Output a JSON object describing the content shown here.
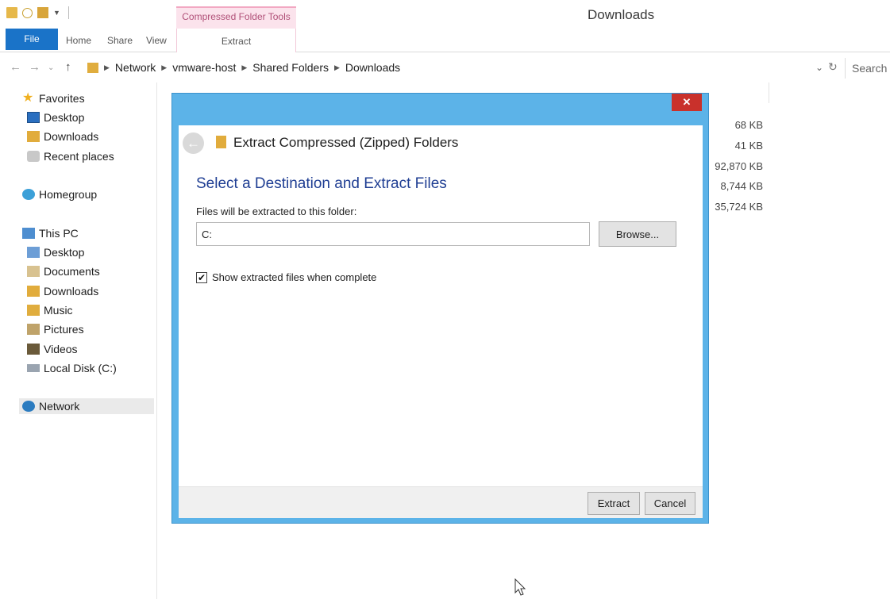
{
  "titlebar": {
    "context_tab": "Compressed Folder Tools",
    "window_title": "Downloads"
  },
  "ribbon": {
    "file": "File",
    "home": "Home",
    "share": "Share",
    "view": "View",
    "extract": "Extract"
  },
  "address": {
    "path": [
      "Network",
      "vmware-host",
      "Shared Folders",
      "Downloads"
    ],
    "search_placeholder": "Search"
  },
  "navpane": {
    "favorites": "Favorites",
    "desktop": "Desktop",
    "downloads": "Downloads",
    "recent": "Recent places",
    "homegroup": "Homegroup",
    "thispc": "This PC",
    "pc_desktop": "Desktop",
    "pc_documents": "Documents",
    "pc_downloads": "Downloads",
    "pc_music": "Music",
    "pc_pictures": "Pictures",
    "pc_videos": "Videos",
    "pc_disk": "Local Disk (C:)",
    "network": "Network"
  },
  "file_sizes": [
    "68 KB",
    "41 KB",
    "92,870 KB",
    "8,744 KB",
    "35,724 KB"
  ],
  "dialog": {
    "close": "✕",
    "title": "Extract Compressed (Zipped) Folders",
    "section_title": "Select a Destination and Extract Files",
    "field_label": "Files will be extracted to this folder:",
    "destination_value": "C:",
    "browse": "Browse...",
    "show_files_label": "Show extracted files when complete",
    "show_files_checked": true,
    "extract": "Extract",
    "cancel": "Cancel"
  }
}
